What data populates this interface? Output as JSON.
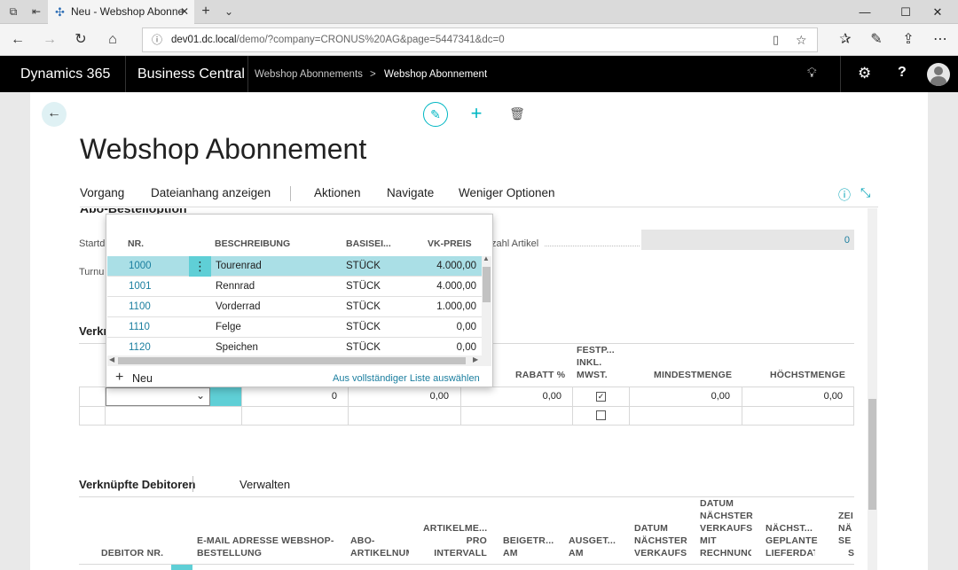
{
  "browser": {
    "tab_title": "Neu - Webshop Abonne",
    "url_host": "dev01.dc.local",
    "url_path": "/demo/?company=CRONUS%20AG&page=5447341&dc=0"
  },
  "header": {
    "product": "Dynamics 365",
    "app": "Business Central",
    "breadcrumb_parent": "Webshop Abonnements",
    "breadcrumb_separator": ">",
    "breadcrumb_current": "Webshop Abonnement",
    "help": "?"
  },
  "page": {
    "title": "Webshop Abonnement"
  },
  "actions": {
    "items": [
      "Vorgang",
      "Dateianhang anzeigen",
      "Aktionen",
      "Navigate",
      "Weniger Optionen"
    ]
  },
  "general": {
    "section_title": "Abo-Bestelloption",
    "start_label": "Startd",
    "turnus_label": "Turnu",
    "anzahl_label": "zahl Artikel",
    "anzahl_value": "0"
  },
  "lines": {
    "section_label": "Verkn",
    "col_rabatt": "RABATT %",
    "col_festp": [
      "FESTP...",
      "INKL.",
      "MWST."
    ],
    "col_mindest": "MINDESTMENGE",
    "col_hoechst": "HÖCHSTMENGE",
    "row1": {
      "qty": "0",
      "price": "0,00",
      "rabatt": "0,00",
      "mindest": "0,00",
      "hoechst": "0,00",
      "festp": "✓"
    }
  },
  "lookup": {
    "col_no": "NR.",
    "col_desc": "BESCHREIBUNG",
    "col_unit": "BASISEI...",
    "col_price": "VK-PREIS",
    "rows": [
      {
        "no": "1000",
        "desc": "Tourenrad",
        "unit": "STÜCK",
        "price": "4.000,00"
      },
      {
        "no": "1001",
        "desc": "Rennrad",
        "unit": "STÜCK",
        "price": "4.000,00"
      },
      {
        "no": "1100",
        "desc": "Vorderrad",
        "unit": "STÜCK",
        "price": "1.000,00"
      },
      {
        "no": "1110",
        "desc": "Felge",
        "unit": "STÜCK",
        "price": "0,00"
      },
      {
        "no": "1120",
        "desc": "Speichen",
        "unit": "STÜCK",
        "price": "0,00"
      }
    ],
    "new_label": "Neu",
    "full_list_label": "Aus vollständiger Liste auswählen",
    "row_menu": "⋮"
  },
  "debitoren": {
    "tab_label": "Verknüpfte Debitoren",
    "manage_label": "Verwalten",
    "col_debitor": "DEBITOR NR.",
    "col_email": [
      "E-MAIL ADRESSE WEBSHOP-",
      "BESTELLUNG"
    ],
    "col_abo": [
      "ABO-",
      "ARTIKELNUM"
    ],
    "col_artikelme": [
      "ARTIKELME...",
      "PRO",
      "INTERVALL"
    ],
    "col_beigetr": [
      "BEIGETR...",
      "AM"
    ],
    "col_ausget": [
      "AUSGET...",
      "AM"
    ],
    "col_datum_verk": [
      "DATUM",
      "NÄCHSTER",
      "VERKAUFS"
    ],
    "col_datum_rech": [
      "DATUM",
      "NÄCHSTER",
      "VERKAUFS",
      "MIT",
      "RECHNUNG"
    ],
    "col_naechst": [
      "NÄCHST...",
      "GEPLANTE",
      "LIEFERDAT"
    ],
    "col_zei": [
      "ZEI",
      "NÄ",
      "SE",
      "S"
    ]
  },
  "colors": {
    "accent": "#00b7c3",
    "link": "#1a7e9f",
    "selected_row": "#aadfe6",
    "header_bg": "#000000"
  }
}
